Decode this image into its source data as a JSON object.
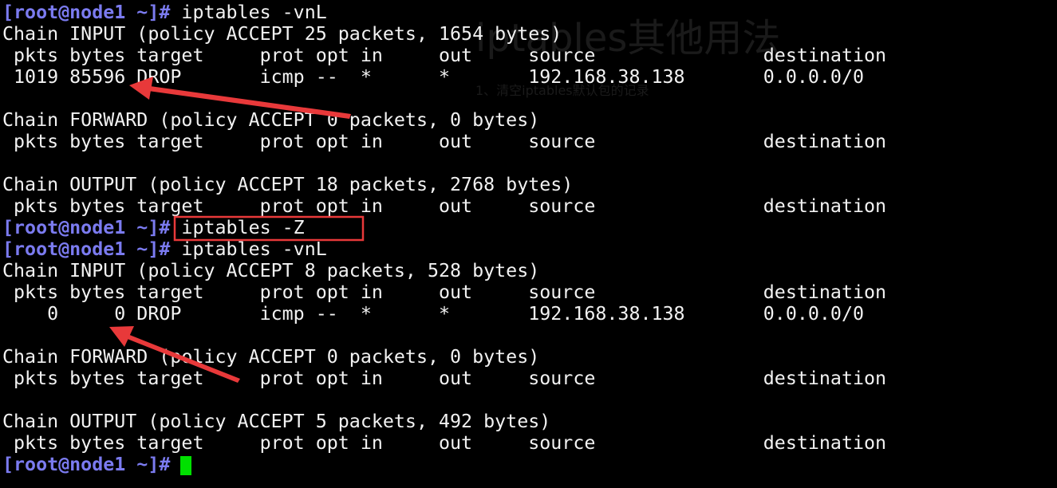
{
  "terminal": {
    "prompt": "[root@node1 ~]#",
    "commands": {
      "first": "iptables -vnL",
      "zero": "iptables -Z",
      "second": "iptables -vnL"
    },
    "block1": {
      "input_chain": "Chain INPUT (policy ACCEPT 25 packets, 1654 bytes)",
      "input_header": " pkts bytes target     prot opt in     out     source               destination",
      "input_rule": " 1019 85596 DROP       icmp --  *      *       192.168.38.138       0.0.0.0/0",
      "forward_chain": "Chain FORWARD (policy ACCEPT 0 packets, 0 bytes)",
      "forward_header": " pkts bytes target     prot opt in     out     source               destination",
      "output_chain": "Chain OUTPUT (policy ACCEPT 18 packets, 2768 bytes)",
      "output_header": " pkts bytes target     prot opt in     out     source               destination"
    },
    "block2": {
      "input_chain": "Chain INPUT (policy ACCEPT 8 packets, 528 bytes)",
      "input_header": " pkts bytes target     prot opt in     out     source               destination",
      "input_rule": "    0     0 DROP       icmp --  *      *       192.168.38.138       0.0.0.0/0",
      "forward_chain": "Chain FORWARD (policy ACCEPT 0 packets, 0 bytes)",
      "forward_header": " pkts bytes target     prot opt in     out     source               destination",
      "output_chain": "Chain OUTPUT (policy ACCEPT 5 packets, 492 bytes)",
      "output_header": " pkts bytes target     prot opt in     out     source               destination"
    }
  },
  "watermark": {
    "title": "iptables其他用法",
    "subtitle": "1、清空iptables默认包的记录"
  },
  "colors": {
    "background": "#000000",
    "text": "#f2f2f2",
    "prompt": "#7b7bf0",
    "cursor": "#00e000",
    "annotation": "#e8393a"
  }
}
